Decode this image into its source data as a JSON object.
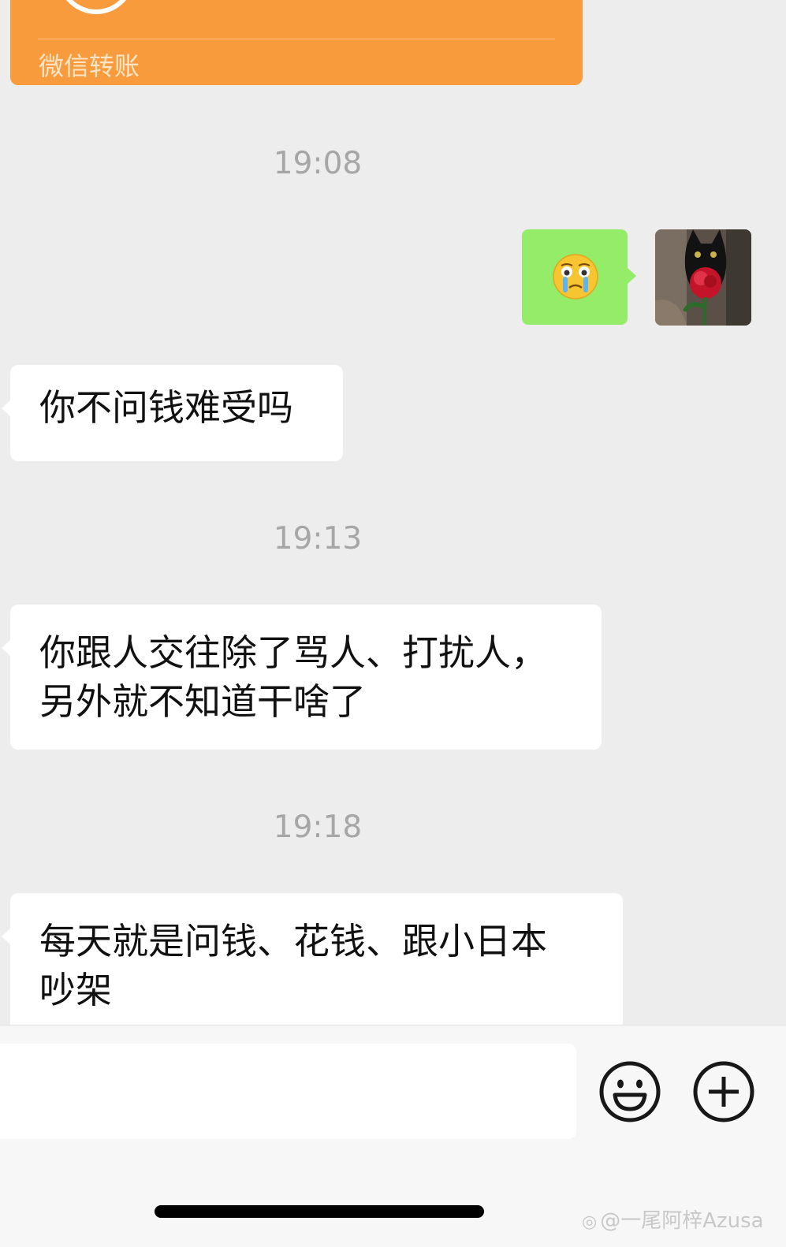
{
  "transfer": {
    "label": "微信转账",
    "color": "#f89b3c"
  },
  "timestamps": [
    "19:08",
    "19:13",
    "19:18"
  ],
  "messages": {
    "outgoing_emoji": {
      "icon": "crying-face-emoji",
      "bubble_color": "#95ec69"
    },
    "m1": "你不问钱难受吗",
    "m2_line1": "你跟人交往除了骂人、打扰人，",
    "m2_line2": "另外就不知道干啥了",
    "m3_line1": "每天就是问钱、花钱、跟小日本",
    "m3_line2": "吵架"
  },
  "avatar": {
    "icon": "black-cat-with-rose-avatar"
  },
  "input_bar": {
    "input_value": "",
    "emoji_button_icon": "smiley-face-icon",
    "more_button_icon": "plus-circle-icon"
  },
  "watermark": {
    "text": "@一尾阿梓Azusa",
    "icon": "weibo-logo-icon"
  }
}
